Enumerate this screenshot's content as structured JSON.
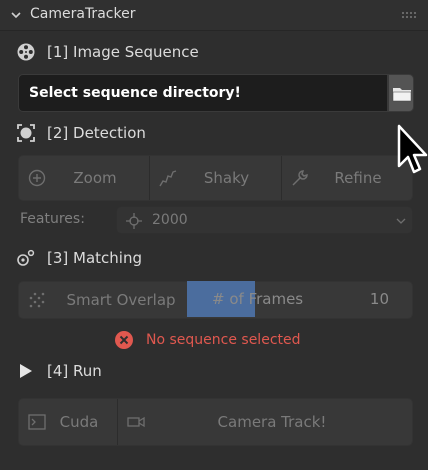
{
  "panel": {
    "title": "CameraTracker"
  },
  "sections": {
    "image_sequence": {
      "label": "[1] Image Sequence",
      "path_value": "Select sequence directory!"
    },
    "detection": {
      "label": "[2] Detection",
      "buttons": [
        "Zoom",
        "Shaky",
        "Refine"
      ],
      "features_label": "Features:",
      "features_value": "2000"
    },
    "matching": {
      "label": "[3] Matching",
      "smart_overlap_label": "Smart Overlap",
      "num_frames_label": "# of Frames",
      "num_frames_value": "10",
      "num_frames_fraction": 0.17,
      "error_text": "No sequence selected"
    },
    "run": {
      "label": "[4] Run",
      "cuda_label": "Cuda",
      "camera_track_label": "Camera Track!"
    }
  },
  "colors": {
    "accent": "#4b6d9e",
    "error": "#e0584f"
  },
  "icons": {
    "collapse": "chevron-down-icon",
    "sequence": "film-reel-icon",
    "detection": "target-icon",
    "matching": "match-icon",
    "run": "play-icon",
    "folder": "folder-icon",
    "zoom": "zoom-icon",
    "shaky": "shaky-icon",
    "refine": "wrench-icon",
    "features": "crosshair-icon",
    "smart_overlap": "scatter-icon",
    "error": "error-x-icon",
    "cuda": "console-icon",
    "camera": "camera-icon"
  }
}
